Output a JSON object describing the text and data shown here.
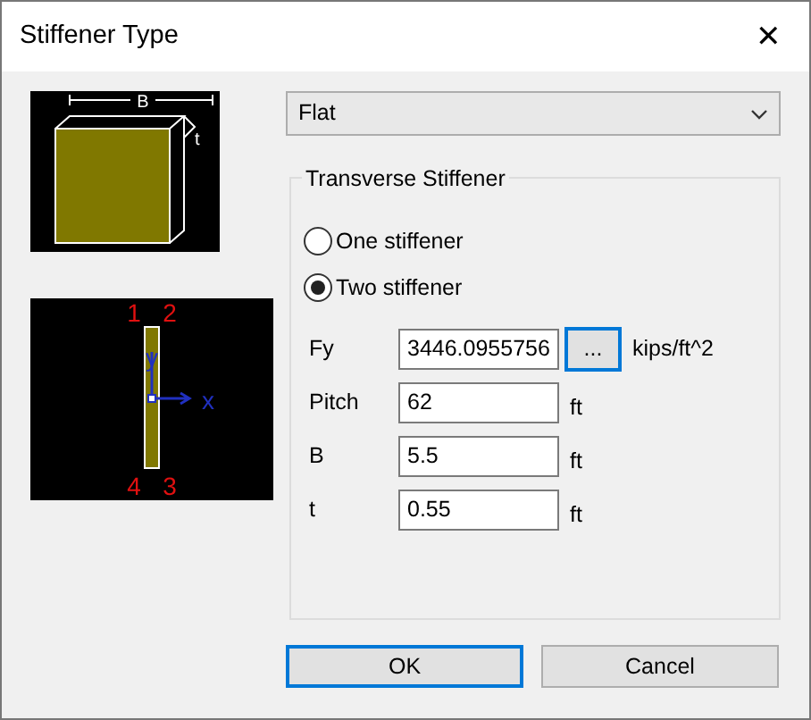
{
  "window": {
    "title": "Stiffener Type",
    "close": "✕"
  },
  "section_diagram": {
    "width_label": "B",
    "thickness_label": "t"
  },
  "plan_diagram": {
    "corner_labels": [
      "1",
      "2",
      "4",
      "3"
    ],
    "axis_y": "y",
    "axis_x": "x"
  },
  "type_dropdown": {
    "value": "Flat"
  },
  "group": {
    "title": "Transverse Stiffener",
    "radios": [
      {
        "label": "One stiffener",
        "selected": false
      },
      {
        "label": "Two stiffener",
        "selected": true
      }
    ],
    "fields": [
      {
        "label": "Fy",
        "value": "3446.0955756",
        "browse": "...",
        "unit": "kips/ft^2"
      },
      {
        "label": "Pitch",
        "value": "62",
        "unit": "ft"
      },
      {
        "label": "B",
        "value": "5.5",
        "unit": "ft"
      },
      {
        "label": "t",
        "value": "0.55",
        "unit": "ft"
      }
    ]
  },
  "buttons": [
    {
      "label": "OK",
      "focused": true
    },
    {
      "label": "Cancel",
      "focused": false
    }
  ]
}
